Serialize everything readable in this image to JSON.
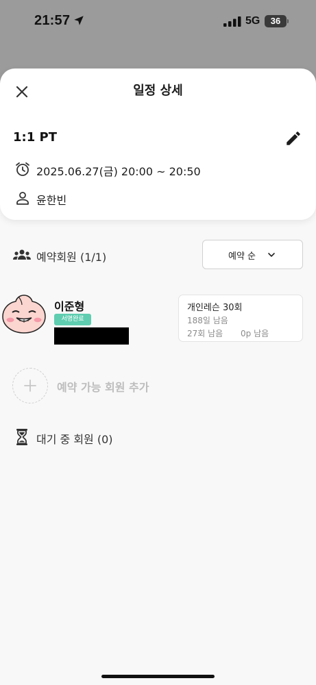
{
  "status_bar": {
    "time": "21:57",
    "network": "5G",
    "battery": "36"
  },
  "sheet": {
    "title": "일정 상세",
    "session_name": "1:1 PT",
    "datetime": "2025.06.27(금) 20:00 ~ 20:50",
    "trainer": "윤한빈"
  },
  "members": {
    "section_label": "예약회원 (1/1)",
    "sort_label": "예약 순",
    "list": [
      {
        "name": "이준형",
        "badge": "서명완료",
        "pass": {
          "name": "개인레슨 30회",
          "days_left": "188일 남음",
          "count_left": "27회 남음",
          "points_left": "0p 남음"
        }
      }
    ],
    "add_label": "예약 가능 회원 추가"
  },
  "waitlist": {
    "label": "대기 중 회원 (0)"
  },
  "colors": {
    "badge": "#5fcdb0",
    "dim_overlay": "#9b9b9b",
    "background": "#f8f8f8"
  },
  "icons": [
    "location-arrow-icon",
    "signal-icon",
    "close-icon",
    "edit-icon",
    "alarm-clock-icon",
    "person-icon",
    "group-icon",
    "chevron-down-icon",
    "plus-icon",
    "hourglass-icon"
  ]
}
